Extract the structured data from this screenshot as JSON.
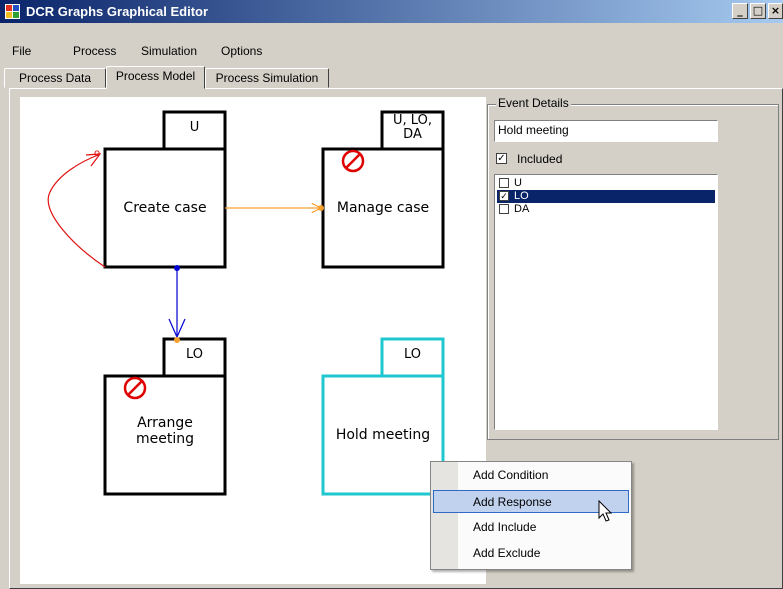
{
  "window": {
    "title": "DCR Graphs Graphical Editor",
    "controls": [
      "_",
      "□",
      "×"
    ]
  },
  "menu": [
    "File",
    "Process",
    "Simulation",
    "Options"
  ],
  "tabs": [
    "Process Data",
    "Process Model",
    "Process Simulation"
  ],
  "active_tab": "Process Model",
  "events": [
    {
      "name": "Create case",
      "roles": "U",
      "blocked": false,
      "selected": false
    },
    {
      "name": "Manage case",
      "roles": "U, LO,\nDA",
      "blocked": true,
      "selected": false
    },
    {
      "name": "Arrange\nmeeting",
      "roles": "LO",
      "blocked": true,
      "selected": false
    },
    {
      "name": "Hold meeting",
      "roles": "LO",
      "blocked": false,
      "selected": true
    }
  ],
  "relations": [
    {
      "from": "Create case",
      "to": "Create case",
      "type": "response",
      "color": "#e01010"
    },
    {
      "from": "Create case",
      "to": "Manage case",
      "type": "include",
      "color": "#f5a030"
    },
    {
      "from": "Create case",
      "to": "Arrange meeting",
      "type": "condition",
      "color": "#0000d0"
    }
  ],
  "event_details": {
    "legend": "Event Details",
    "name_value": "Hold meeting",
    "included_label": "Included",
    "included": true,
    "roles": [
      {
        "label": "U",
        "checked": false,
        "selected": false
      },
      {
        "label": "LO",
        "checked": true,
        "selected": true
      },
      {
        "label": "DA",
        "checked": false,
        "selected": false
      }
    ]
  },
  "context_menu": {
    "items": [
      "Add Condition",
      "Add Response",
      "Add Include",
      "Add Exclude"
    ],
    "highlighted": "Add Response"
  },
  "colors": {
    "selected_event": "#1fc7cf",
    "titlebar_start": "#0a246a",
    "titlebar_end": "#a6caf0",
    "blocked_icon": "#e00000"
  }
}
